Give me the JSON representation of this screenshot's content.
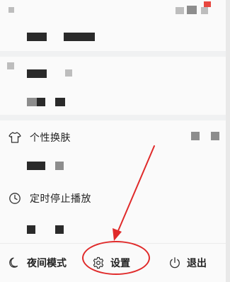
{
  "menu": {
    "skin_item": {
      "label": "个性换肤",
      "icon": "tshirt-icon"
    },
    "timer_item": {
      "label": "定时停止播放",
      "icon": "clock-icon"
    }
  },
  "bottom_bar": {
    "night_mode": {
      "label": "夜间模式",
      "icon": "moon-icon"
    },
    "settings": {
      "label": "设置",
      "icon": "gear-icon"
    },
    "logout": {
      "label": "退出",
      "icon": "power-icon"
    }
  },
  "annotation": {
    "color": "#e02a2a",
    "target": "settings"
  }
}
